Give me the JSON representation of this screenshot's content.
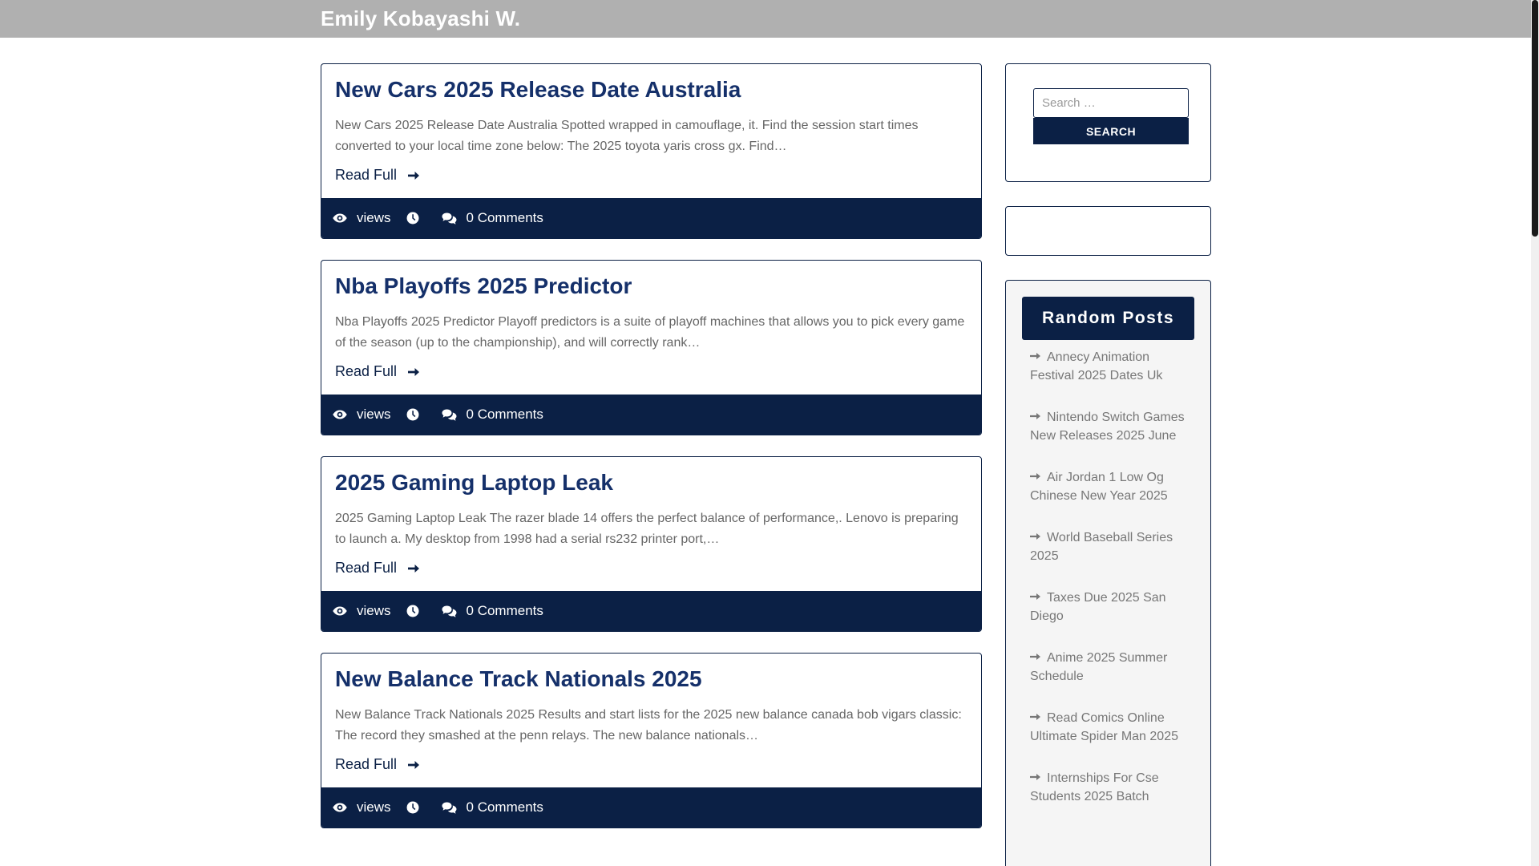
{
  "site": {
    "title": "Emily Kobayashi W."
  },
  "posts": [
    {
      "title": "New Cars 2025 Release Date Australia",
      "excerpt": "New Cars 2025 Release Date Australia Spotted wrapped in camouflage, it. Find the session start times converted to your local time zone below: The 2025 toyota yaris cross gx. Find…",
      "read_more": "Read Full",
      "views_label": "views",
      "comments_label": "0 Comments"
    },
    {
      "title": "Nba Playoffs 2025 Predictor",
      "excerpt": "Nba Playoffs 2025 Predictor Playoff predictors is a suite of playoff machines that allows you to pick every game of the season (up to the championship), and will correctly rank…",
      "read_more": "Read Full",
      "views_label": "views",
      "comments_label": "0 Comments"
    },
    {
      "title": "2025 Gaming Laptop Leak",
      "excerpt": "2025 Gaming Laptop Leak The razer blade 14 offers the perfect balance of performance,. Lenovo is preparing to launch a. My desktop from 1998 had a serial rs232 printer port,…",
      "read_more": "Read Full",
      "views_label": "views",
      "comments_label": "0 Comments"
    },
    {
      "title": "New Balance Track Nationals 2025",
      "excerpt": "New Balance Track Nationals 2025 Results and start lists for the 2025 new balance canada bob vigars classic: The record they smashed at the penn relays. The new balance nationals…",
      "read_more": "Read Full",
      "views_label": "views",
      "comments_label": "0 Comments"
    }
  ],
  "icons": {
    "views": "eye-icon",
    "time": "clock-icon",
    "comments": "comments-icon",
    "read_more": "arrow-right-icon",
    "list_bullet": "arrow-right-icon"
  },
  "colors": {
    "brand": "#0b2045",
    "title": "#15306a",
    "header": "#b0b0b0"
  },
  "sidebar": {
    "search": {
      "placeholder": "Search …",
      "button_label": "SEARCH"
    },
    "random_posts": {
      "title": "Random Posts",
      "items": [
        "Annecy Animation Festival 2025 Dates Uk",
        "Nintendo Switch Games New Releases 2025 June",
        "Air Jordan 1 Low Og Chinese New Year 2025",
        "World Baseball Series 2025",
        "Taxes Due 2025 San Diego",
        "Anime 2025 Summer Schedule",
        "Read Comics Online Ultimate Spider Man 2025",
        "Internships For Cse Students 2025 Batch"
      ]
    }
  }
}
